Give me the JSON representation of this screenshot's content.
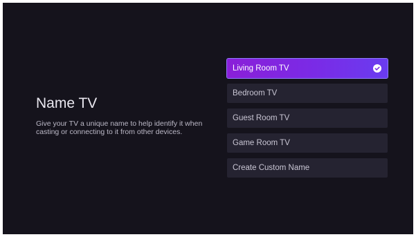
{
  "page": {
    "title": "Name TV",
    "description": "Give your TV a unique name to help identify it when casting or connecting to it from other devices."
  },
  "options": [
    {
      "label": "Living Room TV",
      "selected": true
    },
    {
      "label": "Bedroom TV",
      "selected": false
    },
    {
      "label": "Guest Room TV",
      "selected": false
    },
    {
      "label": "Game Room TV",
      "selected": false
    },
    {
      "label": "Create Custom Name",
      "selected": false
    }
  ],
  "icons": {
    "selected_indicator": "check-circle-icon"
  },
  "colors": {
    "background": "#15131c",
    "option_bg": "#252331",
    "accent_start": "#8a1fd8",
    "accent_end": "#6a3cf0",
    "title_text": "#e9e7ef",
    "body_text": "#bcb9c7"
  }
}
